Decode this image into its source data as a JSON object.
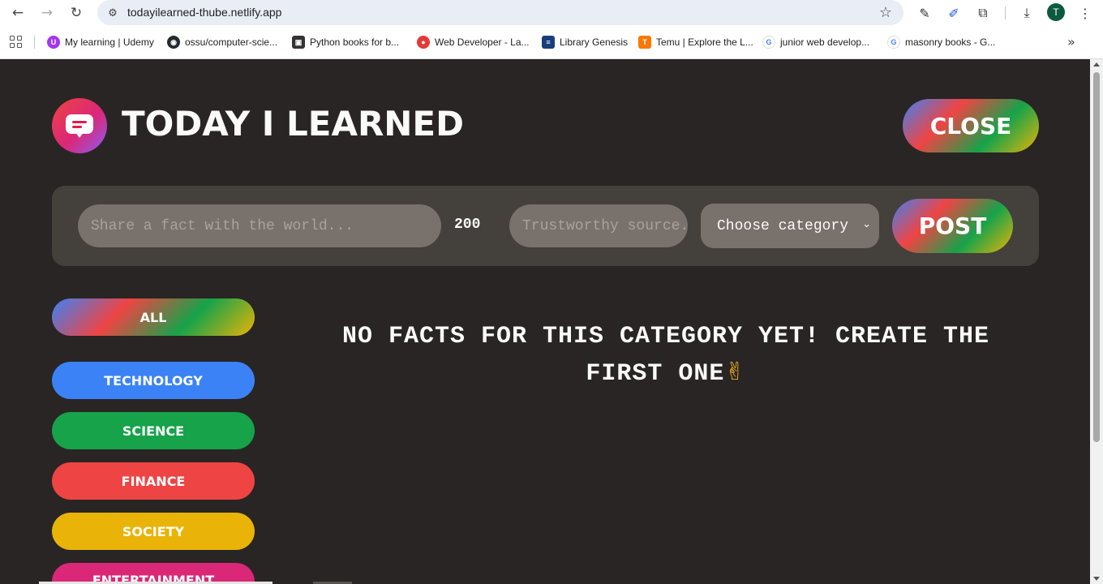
{
  "browser": {
    "url": "todayilearned-thube.netlify.app",
    "profile_initial": "T",
    "bookmarks": [
      {
        "label": "My learning | Udemy",
        "icon": "udemy-icon",
        "color": "#a435f0"
      },
      {
        "label": "ossu/computer-scie...",
        "icon": "github-icon",
        "color": "#24292f"
      },
      {
        "label": "Python books for b...",
        "icon": "book-icon",
        "color": "#333333"
      },
      {
        "label": "Web Developer - La...",
        "icon": "circle-icon",
        "color": "#e53935"
      },
      {
        "label": "Library Genesis",
        "icon": "library-icon",
        "color": "#1a3d7c"
      },
      {
        "label": "Temu | Explore the L...",
        "icon": "temu-icon",
        "color": "#fb7701"
      },
      {
        "label": "junior web develop...",
        "icon": "google-icon",
        "color": "#4285f4"
      },
      {
        "label": "masonry books - G...",
        "icon": "google-icon",
        "color": "#4285f4"
      }
    ]
  },
  "header": {
    "title": "Today I Learned",
    "close_label": "Close"
  },
  "form": {
    "fact_placeholder": "Share a fact with the world...",
    "char_count": "200",
    "source_placeholder": "Trustworthy source...",
    "category_placeholder": "Choose category",
    "post_label": "Post"
  },
  "categories": [
    {
      "label": "All",
      "color": "gradient"
    },
    {
      "label": "Technology",
      "color": "#3b82f6"
    },
    {
      "label": "Science",
      "color": "#16a34a"
    },
    {
      "label": "Finance",
      "color": "#ef4444"
    },
    {
      "label": "Society",
      "color": "#eab308"
    },
    {
      "label": "Entertainment",
      "color": "#db2777"
    }
  ],
  "message": {
    "text": "No facts for this category yet! Create the first one",
    "emoji": "✌"
  }
}
